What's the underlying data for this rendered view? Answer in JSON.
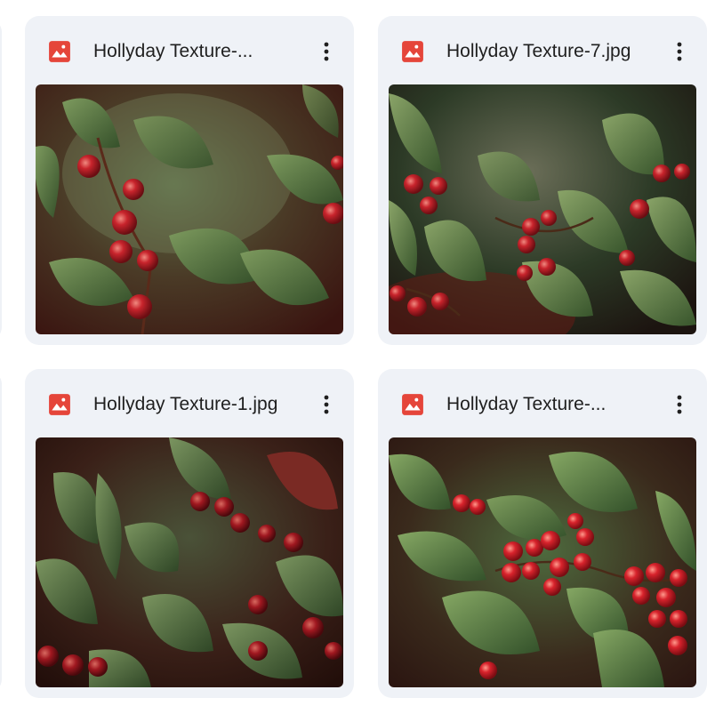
{
  "files": [
    {
      "name": "Hollyday Texture-...",
      "type_icon": "image-file-icon",
      "menu_icon": "more-vert-icon",
      "thumbnail": "holly leaves and red berries, blurred red-green background"
    },
    {
      "name": "Hollyday Texture-7.jpg",
      "type_icon": "image-file-icon",
      "menu_icon": "more-vert-icon",
      "thumbnail": "holly leaves and red berries on dark green misty background"
    },
    {
      "name": "Hollyday Texture-1.jpg",
      "type_icon": "image-file-icon",
      "menu_icon": "more-vert-icon",
      "thumbnail": "dense holly leaves with dark red berries"
    },
    {
      "name": "Hollyday Texture-...",
      "type_icon": "image-file-icon",
      "menu_icon": "more-vert-icon",
      "thumbnail": "glossy holly leaves with bright red berry clusters"
    }
  ],
  "colors": {
    "card_bg": "#eff2f7",
    "image_icon": "#e5453a",
    "text": "#1f1f1f",
    "leaf": "#4d6b3c",
    "berry": "#c0202a",
    "dark_bg": "#2a2418"
  }
}
